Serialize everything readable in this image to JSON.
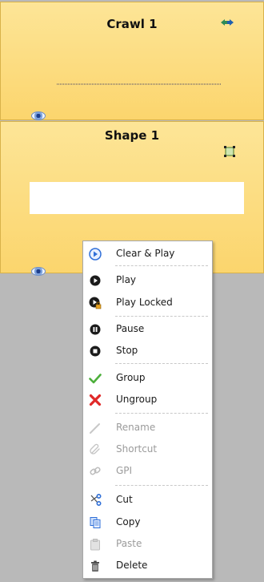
{
  "panels": [
    {
      "title": "Crawl 1"
    },
    {
      "title": "Shape 1"
    }
  ],
  "menu": {
    "items": [
      {
        "label": "Clear & Play",
        "icon": "clear-play-icon",
        "enabled": true
      },
      {
        "label": "Play",
        "icon": "play-icon",
        "enabled": true
      },
      {
        "label": "Play Locked",
        "icon": "play-locked-icon",
        "enabled": true
      },
      {
        "label": "Pause",
        "icon": "pause-icon",
        "enabled": true
      },
      {
        "label": "Stop",
        "icon": "stop-icon",
        "enabled": true
      },
      {
        "label": "Group",
        "icon": "check-icon",
        "enabled": true
      },
      {
        "label": "Ungroup",
        "icon": "x-icon",
        "enabled": true
      },
      {
        "label": "Rename",
        "icon": "pencil-icon",
        "enabled": false
      },
      {
        "label": "Shortcut",
        "icon": "paperclip-icon",
        "enabled": false
      },
      {
        "label": "GPI",
        "icon": "link-icon",
        "enabled": false
      },
      {
        "label": "Cut",
        "icon": "scissors-icon",
        "enabled": true
      },
      {
        "label": "Copy",
        "icon": "copy-icon",
        "enabled": true
      },
      {
        "label": "Paste",
        "icon": "paste-icon",
        "enabled": false
      },
      {
        "label": "Delete",
        "icon": "trash-icon",
        "enabled": true
      }
    ]
  },
  "colors": {
    "panel_bg": "#fbd56d",
    "workspace_bg": "#b9b9b9",
    "accent_blue": "#2f6fd8",
    "group_green": "#4caf3b",
    "ungroup_red": "#e02828"
  }
}
